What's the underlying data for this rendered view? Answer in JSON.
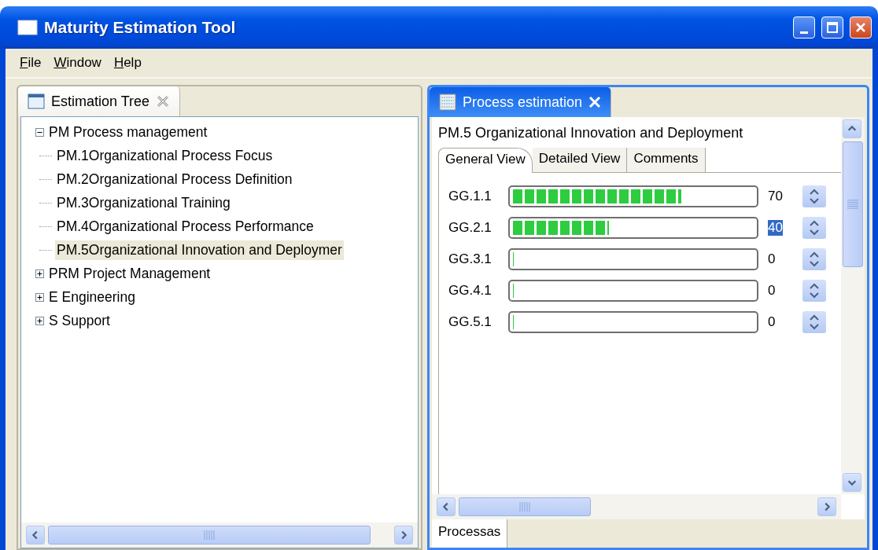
{
  "window": {
    "title": "Maturity Estimation Tool"
  },
  "menu": [
    {
      "label": "File"
    },
    {
      "label": "Window"
    },
    {
      "label": "Help"
    }
  ],
  "tree_view": {
    "tab": {
      "label": "Estimation Tree",
      "selected": false
    },
    "items": [
      {
        "label": "PM Process management",
        "expanded": true,
        "selected": false,
        "children": [
          {
            "label": "PM.1Organizational Process Focus",
            "selected": false
          },
          {
            "label": "PM.2Organizational Process Definition",
            "selected": false
          },
          {
            "label": "PM.3Organizational Training",
            "selected": false
          },
          {
            "label": "PM.4Organizational Process Performance",
            "selected": false
          },
          {
            "label": "PM.5Organizational Innovation and Deploymer",
            "selected": true
          }
        ]
      },
      {
        "label": "PRM Project Management",
        "expanded": false,
        "selected": false
      },
      {
        "label": "E Engineering",
        "expanded": false,
        "selected": false
      },
      {
        "label": "S Support",
        "expanded": false,
        "selected": false
      }
    ]
  },
  "editor": {
    "tab": {
      "label": "Process estimation",
      "selected": true
    },
    "heading": "PM.5 Organizational Innovation and Deployment",
    "tabs": [
      {
        "label": "General View",
        "selected": true
      },
      {
        "label": "Detailed View",
        "selected": false
      },
      {
        "label": "Comments",
        "selected": false
      }
    ],
    "goals": [
      {
        "name": "GG.1.1",
        "level": 0.7,
        "value": "70",
        "selected": false
      },
      {
        "name": "GG.2.1",
        "level": 0.4,
        "value": "40",
        "selected": true
      },
      {
        "name": "GG.3.1",
        "level": 0,
        "value": "0",
        "selected": false
      },
      {
        "name": "GG.4.1",
        "level": 0,
        "value": "0",
        "selected": false
      },
      {
        "name": "GG.5.1",
        "level": 0,
        "value": "0",
        "selected": false
      }
    ],
    "bottom_tabs": [
      {
        "label": "Processas",
        "selected": true
      }
    ]
  }
}
